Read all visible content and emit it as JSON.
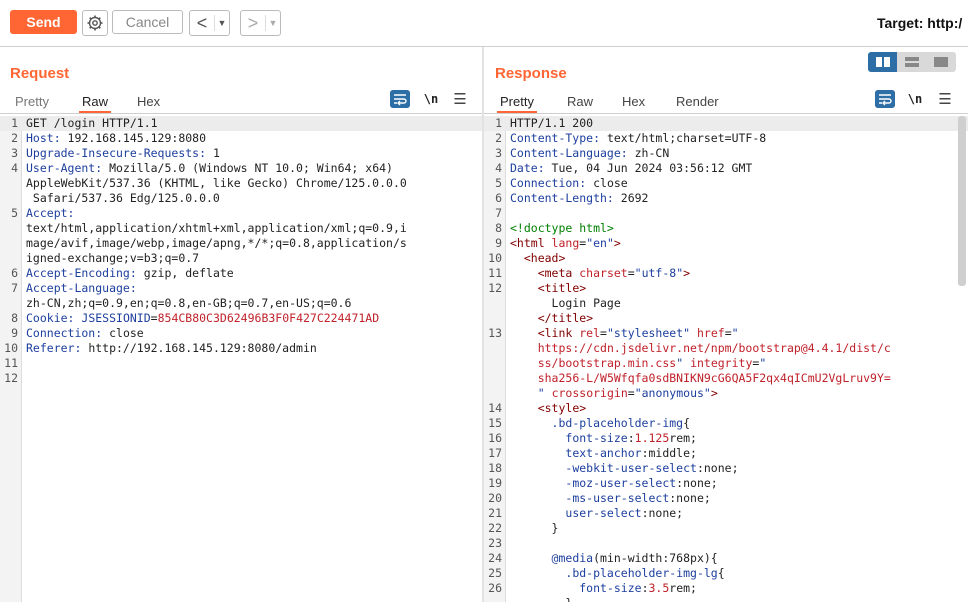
{
  "toolbar": {
    "send_label": "Send",
    "cancel_label": "Cancel",
    "back_arrow": "<",
    "forward_arrow": ">",
    "dropdown_glyph": "▼",
    "target_label": "Target: http:/"
  },
  "request": {
    "title": "Request",
    "tabs": [
      "Pretty",
      "Raw",
      "Hex"
    ],
    "active_tab": "Raw",
    "newline_label": "\\n",
    "lines": [
      {
        "n": "1",
        "hl": true,
        "parts": [
          [
            "v",
            "GET /login HTTP/1.1"
          ]
        ]
      },
      {
        "n": "2",
        "parts": [
          [
            "k",
            "Host:"
          ],
          [
            "v",
            " 192.168.145.129:8080"
          ]
        ]
      },
      {
        "n": "3",
        "parts": [
          [
            "k",
            "Upgrade-Insecure-Requests:"
          ],
          [
            "v",
            " 1"
          ]
        ]
      },
      {
        "n": "4",
        "parts": [
          [
            "k",
            "User-Agent:"
          ],
          [
            "v",
            " Mozilla/5.0 (Windows NT 10.0; Win64; x64)"
          ]
        ]
      },
      {
        "n": "",
        "parts": [
          [
            "v",
            "AppleWebKit/537.36 (KHTML, like Gecko) Chrome/125.0.0.0"
          ]
        ]
      },
      {
        "n": "",
        "parts": [
          [
            "v",
            " Safari/537.36 Edg/125.0.0.0"
          ]
        ]
      },
      {
        "n": "5",
        "parts": [
          [
            "k",
            "Accept:"
          ]
        ]
      },
      {
        "n": "",
        "parts": [
          [
            "v",
            "text/html,application/xhtml+xml,application/xml;q=0.9,i"
          ]
        ]
      },
      {
        "n": "",
        "parts": [
          [
            "v",
            "mage/avif,image/webp,image/apng,*/*;q=0.8,application/s"
          ]
        ]
      },
      {
        "n": "",
        "parts": [
          [
            "v",
            "igned-exchange;v=b3;q=0.7"
          ]
        ]
      },
      {
        "n": "6",
        "parts": [
          [
            "k",
            "Accept-Encoding:"
          ],
          [
            "v",
            " gzip, deflate"
          ]
        ]
      },
      {
        "n": "7",
        "parts": [
          [
            "k",
            "Accept-Language:"
          ]
        ]
      },
      {
        "n": "",
        "parts": [
          [
            "v",
            "zh-CN,zh;q=0.9,en;q=0.8,en-GB;q=0.7,en-US;q=0.6"
          ]
        ]
      },
      {
        "n": "8",
        "parts": [
          [
            "k",
            "Cookie:"
          ],
          [
            "v",
            " "
          ],
          [
            "k",
            "JSESSIONID"
          ],
          [
            "v",
            "="
          ],
          [
            "red",
            "854CB80C3D62496B3F0F427C224471AD"
          ]
        ]
      },
      {
        "n": "9",
        "parts": [
          [
            "k",
            "Connection:"
          ],
          [
            "v",
            " close"
          ]
        ]
      },
      {
        "n": "10",
        "parts": [
          [
            "k",
            "Referer:"
          ],
          [
            "v",
            " http://192.168.145.129:8080/admin"
          ]
        ]
      },
      {
        "n": "11",
        "parts": [
          [
            "v",
            ""
          ]
        ]
      },
      {
        "n": "12",
        "parts": [
          [
            "v",
            ""
          ]
        ]
      }
    ]
  },
  "response": {
    "title": "Response",
    "tabs": [
      "Pretty",
      "Raw",
      "Hex",
      "Render"
    ],
    "active_tab": "Pretty",
    "newline_label": "\\n",
    "lines": [
      {
        "n": "1",
        "hl": true,
        "parts": [
          [
            "v",
            "HTTP/1.1 200"
          ]
        ]
      },
      {
        "n": "2",
        "parts": [
          [
            "k",
            "Content-Type:"
          ],
          [
            "v",
            " text/html;charset=UTF-8"
          ]
        ]
      },
      {
        "n": "3",
        "parts": [
          [
            "k",
            "Content-Language:"
          ],
          [
            "v",
            " zh-CN"
          ]
        ]
      },
      {
        "n": "4",
        "parts": [
          [
            "k",
            "Date:"
          ],
          [
            "v",
            " Tue, 04 Jun 2024 03:56:12 GMT"
          ]
        ]
      },
      {
        "n": "5",
        "parts": [
          [
            "k",
            "Connection:"
          ],
          [
            "v",
            " close"
          ]
        ]
      },
      {
        "n": "6",
        "parts": [
          [
            "k",
            "Content-Length:"
          ],
          [
            "v",
            " 2692"
          ]
        ]
      },
      {
        "n": "7",
        "parts": [
          [
            "v",
            ""
          ]
        ]
      },
      {
        "n": "8",
        "parts": [
          [
            "grn",
            "<!doctype html>"
          ]
        ]
      },
      {
        "n": "9",
        "parts": [
          [
            "tag",
            "<html "
          ],
          [
            "attr",
            "lang"
          ],
          [
            "v",
            "="
          ],
          [
            "str",
            "\"en\""
          ],
          [
            "tag",
            ">"
          ]
        ]
      },
      {
        "n": "10",
        "parts": [
          [
            "v",
            "  "
          ],
          [
            "tag",
            "<head>"
          ]
        ]
      },
      {
        "n": "11",
        "parts": [
          [
            "v",
            "    "
          ],
          [
            "tag",
            "<meta "
          ],
          [
            "attr",
            "charset"
          ],
          [
            "v",
            "="
          ],
          [
            "str",
            "\"utf-8\""
          ],
          [
            "tag",
            ">"
          ]
        ]
      },
      {
        "n": "12",
        "parts": [
          [
            "v",
            "    "
          ],
          [
            "tag",
            "<title>"
          ]
        ]
      },
      {
        "n": "",
        "parts": [
          [
            "v",
            "      Login Page"
          ]
        ]
      },
      {
        "n": "",
        "parts": [
          [
            "v",
            "    "
          ],
          [
            "tag",
            "</title>"
          ]
        ]
      },
      {
        "n": "13",
        "parts": [
          [
            "v",
            "    "
          ],
          [
            "tag",
            "<link "
          ],
          [
            "attr",
            "rel"
          ],
          [
            "v",
            "="
          ],
          [
            "str",
            "\"stylesheet\""
          ],
          [
            "v",
            " "
          ],
          [
            "attr",
            "href"
          ],
          [
            "v",
            "="
          ],
          [
            "str",
            "\""
          ]
        ]
      },
      {
        "n": "",
        "parts": [
          [
            "v",
            "    "
          ],
          [
            "url",
            "https://cdn.jsdelivr.net/npm/bootstrap@4.4.1/dist/c"
          ]
        ]
      },
      {
        "n": "",
        "parts": [
          [
            "v",
            "    "
          ],
          [
            "url",
            "ss/bootstrap.min.css"
          ],
          [
            "str",
            "\""
          ],
          [
            "v",
            " "
          ],
          [
            "attr",
            "integrity"
          ],
          [
            "v",
            "="
          ],
          [
            "str",
            "\""
          ]
        ]
      },
      {
        "n": "",
        "parts": [
          [
            "v",
            "    "
          ],
          [
            "url",
            "sha256-L/W5Wfqfa0sdBNIKN9cG6QA5F2qx4qICmU2VgLruv9Y="
          ]
        ]
      },
      {
        "n": "",
        "parts": [
          [
            "v",
            "    "
          ],
          [
            "str",
            "\""
          ],
          [
            "v",
            " "
          ],
          [
            "attr",
            "crossorigin"
          ],
          [
            "v",
            "="
          ],
          [
            "str",
            "\"anonymous\""
          ],
          [
            "tag",
            ">"
          ]
        ]
      },
      {
        "n": "14",
        "parts": [
          [
            "v",
            "    "
          ],
          [
            "tag",
            "<style>"
          ]
        ]
      },
      {
        "n": "15",
        "parts": [
          [
            "v",
            "      "
          ],
          [
            "k",
            ".bd-placeholder-img"
          ],
          [
            "v",
            "{"
          ]
        ]
      },
      {
        "n": "16",
        "parts": [
          [
            "v",
            "        "
          ],
          [
            "k",
            "font-size"
          ],
          [
            "v",
            ":"
          ],
          [
            "red",
            "1.125"
          ],
          [
            "v",
            "rem;"
          ]
        ]
      },
      {
        "n": "17",
        "parts": [
          [
            "v",
            "        "
          ],
          [
            "k",
            "text-anchor"
          ],
          [
            "v",
            ":middle;"
          ]
        ]
      },
      {
        "n": "18",
        "parts": [
          [
            "v",
            "        "
          ],
          [
            "k",
            "-webkit-user-select"
          ],
          [
            "v",
            ":none;"
          ]
        ]
      },
      {
        "n": "19",
        "parts": [
          [
            "v",
            "        "
          ],
          [
            "k",
            "-moz-user-select"
          ],
          [
            "v",
            ":none;"
          ]
        ]
      },
      {
        "n": "20",
        "parts": [
          [
            "v",
            "        "
          ],
          [
            "k",
            "-ms-user-select"
          ],
          [
            "v",
            ":none;"
          ]
        ]
      },
      {
        "n": "21",
        "parts": [
          [
            "v",
            "        "
          ],
          [
            "k",
            "user-select"
          ],
          [
            "v",
            ":none;"
          ]
        ]
      },
      {
        "n": "22",
        "parts": [
          [
            "v",
            "      }"
          ]
        ]
      },
      {
        "n": "23",
        "parts": [
          [
            "v",
            ""
          ]
        ]
      },
      {
        "n": "24",
        "parts": [
          [
            "v",
            "      "
          ],
          [
            "k",
            "@media"
          ],
          [
            "v",
            "(min-width:768px){"
          ]
        ]
      },
      {
        "n": "25",
        "parts": [
          [
            "v",
            "        "
          ],
          [
            "k",
            ".bd-placeholder-img-lg"
          ],
          [
            "v",
            "{"
          ]
        ]
      },
      {
        "n": "26",
        "parts": [
          [
            "v",
            "          "
          ],
          [
            "k",
            "font-size"
          ],
          [
            "v",
            ":"
          ],
          [
            "red",
            "3.5"
          ],
          [
            "v",
            "rem;"
          ]
        ]
      },
      {
        "n": "",
        "parts": [
          [
            "v",
            "        }"
          ]
        ]
      }
    ]
  },
  "icons": {
    "gear": "gear-icon",
    "wrap": "word-wrap-icon",
    "newline": "newline-icon",
    "menu": "hamburger-menu-icon",
    "view_layouts": [
      "split-horizontal-icon",
      "split-vertical-icon",
      "single-pane-icon"
    ]
  },
  "colors": {
    "accent": "#ff6633",
    "blue": "#2e6ea6"
  }
}
